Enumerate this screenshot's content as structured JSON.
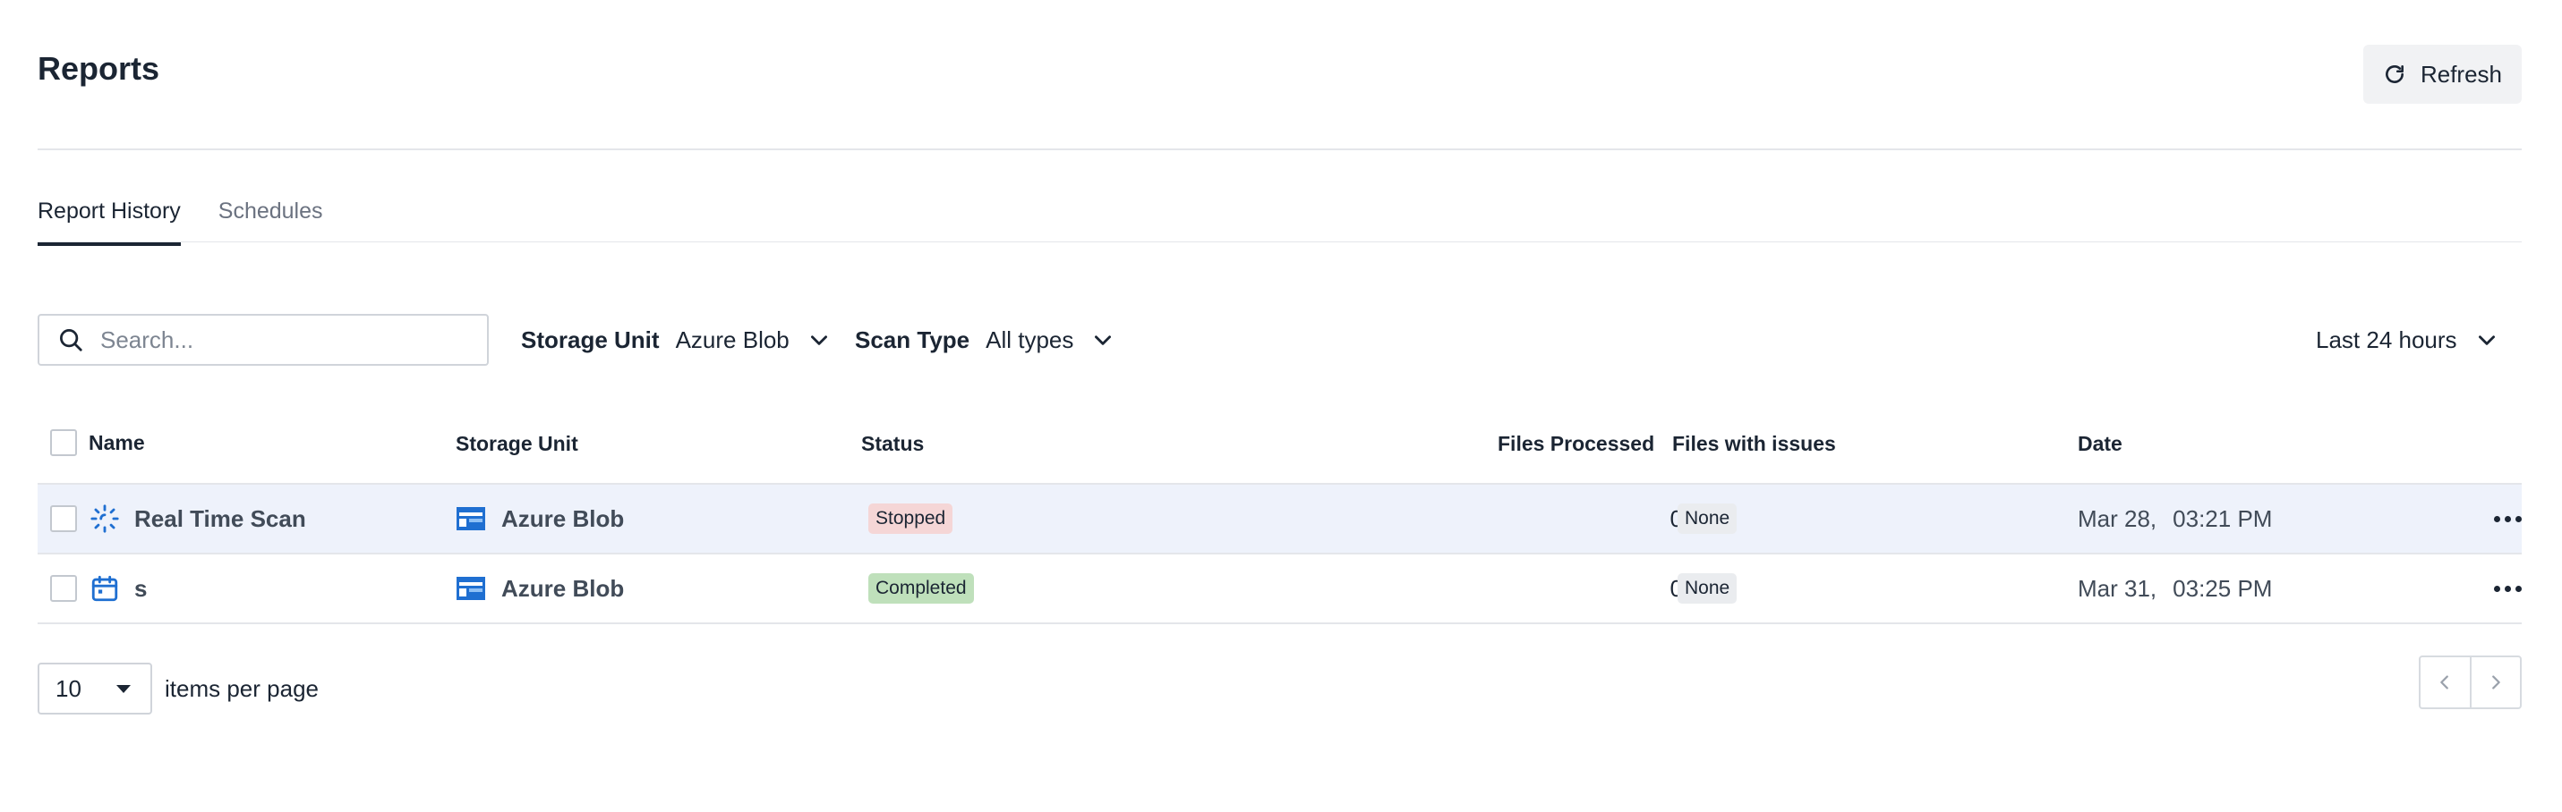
{
  "page": {
    "title": "Reports"
  },
  "header": {
    "refresh_label": "Refresh"
  },
  "tabs": [
    {
      "label": "Report History",
      "active": true
    },
    {
      "label": "Schedules",
      "active": false
    }
  ],
  "filters": {
    "search_placeholder": "Search...",
    "storage_unit": {
      "label": "Storage Unit",
      "value": "Azure Blob"
    },
    "scan_type": {
      "label": "Scan Type",
      "value": "All types"
    },
    "time_range": {
      "value": "Last 24 hours"
    }
  },
  "table": {
    "columns": [
      "Name",
      "Storage Unit",
      "Status",
      "Files Processed",
      "Files with issues",
      "Date"
    ],
    "rows": [
      {
        "icon": "realtime-scan-icon",
        "name": "Real Time Scan",
        "storage": "Azure Blob",
        "status": "Stopped",
        "files_processed": "0",
        "issues": "None",
        "date": "Mar 28,",
        "time": "03:21 PM"
      },
      {
        "icon": "calendar-icon",
        "name": "s",
        "storage": "Azure Blob",
        "status": "Completed",
        "files_processed": "0",
        "issues": "None",
        "date": "Mar 31,",
        "time": "03:25 PM"
      }
    ]
  },
  "pagination": {
    "per_page": "10",
    "per_page_label": "items per page"
  },
  "colors": {
    "stopped_badge": "#f5d6d6",
    "completed_badge": "#bfe0bb",
    "azure_icon": "#1f6fd1",
    "row_highlight": "#eef2fb"
  }
}
